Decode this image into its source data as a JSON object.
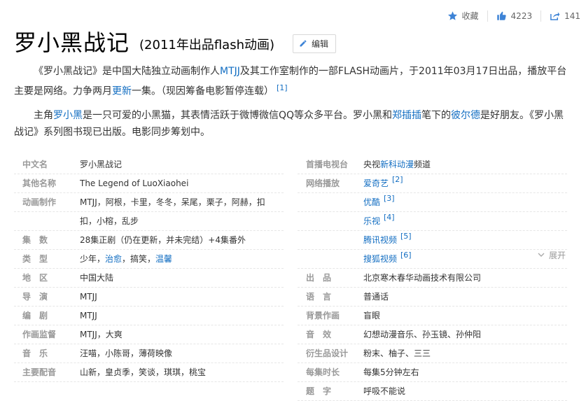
{
  "topbar": {
    "favorite_label": "收藏",
    "like_count": "4223",
    "share_count": "141"
  },
  "header": {
    "title": "罗小黑战记",
    "subtitle": "(2011年出品flash动画)",
    "edit_label": "编辑"
  },
  "intro": {
    "p1_a": "《罗小黑战记》是中国大陆独立动画制作人",
    "p1_link1": "MTJJ",
    "p1_b": "及其工作室制作的一部FLASH动画片，于2011年03月17日出品，播放平台主要是网络。力争两月",
    "p1_link2": "更新",
    "p1_c": "一集。（现因筹备电影暂停连载）",
    "p1_ref": "[1]",
    "p2_a": "主角",
    "p2_link1": "罗小黑",
    "p2_b": "是一只可爱的小黑猫，其表情活跃于微博微信QQ等众多平台。罗小黑和",
    "p2_link2": "郑插插",
    "p2_c": "笔下的",
    "p2_link3": "彼尔德",
    "p2_d": "是好朋友。《罗小黑战记》系列图书现已出版。电影同步筹划中。"
  },
  "info": {
    "left": {
      "k0": "中文名",
      "v0": "罗小黑战记",
      "k1": "其他名称",
      "v1": "The Legend of LuoXiaohei",
      "k2": "动画制作",
      "v2a": "MTJJ，阿根，卡里，冬冬，呆尾，栗子，阿赫，扣",
      "v2b": "扣，小榕，乱步",
      "k3": "集　数",
      "v3": "28集正剧（仍在更新，并未完结）+4集番外",
      "k4": "类　型",
      "v4a": "少年，",
      "v4b": "治愈",
      "v4c": "，搞笑，",
      "v4d": "温馨",
      "k5": "地　区",
      "v5": "中国大陆",
      "k6": "导　演",
      "v6": "MTJJ",
      "k7": "编　剧",
      "v7": "MTJJ",
      "k8": "作画监督",
      "v8": "MTJJ，大爽",
      "k9": "音　乐",
      "v9": "汪喵，小陈哥，薄荷映像",
      "k10": "主要配音",
      "v10": "山新，皇贞季，笑谈，琪琪，桃宝"
    },
    "right": {
      "k0": "首播电视台",
      "v0a": "央视",
      "v0b": "新科动漫",
      "v0c": "频道",
      "k1": "网络播放",
      "v1": "爱奇艺",
      "r1": "[2]",
      "v2": "优酷",
      "r2": "[3]",
      "v3": "乐视",
      "r3": "[4]",
      "v4": "腾讯视频",
      "r4": "[5]",
      "v5": "搜狐视频",
      "r5": "[6]",
      "k6": "出　品",
      "v6": "北京寒木春华动画技术有限公司",
      "k7": "语　言",
      "v7": "普通话",
      "k8": "背景作画",
      "v8": "盲眼",
      "k9": "音　效",
      "v9": "幻想动漫音乐、孙玉镜、孙仲阳",
      "k10": "衍生品设计",
      "v10": "粉末、柚子、三三",
      "k11": "每集时长",
      "v11": "每集5分钟左右",
      "k12": "题　字",
      "v12": "呼吸不能说"
    },
    "expand_label": "展开"
  },
  "colors": {
    "link": "#136ec2",
    "key": "#999999",
    "icon": "#3d83d6"
  }
}
